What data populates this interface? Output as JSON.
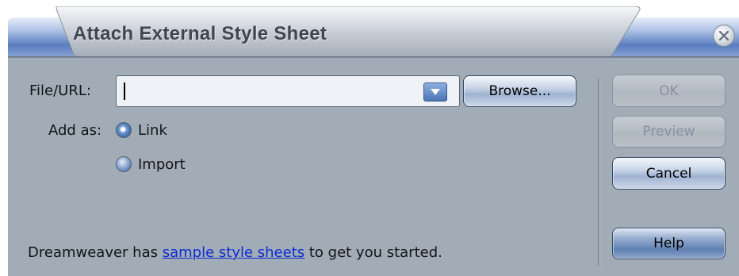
{
  "dialog": {
    "title": "Attach External Style Sheet",
    "close_icon": "close-icon"
  },
  "form": {
    "file_label": "File/URL:",
    "file_value": "",
    "file_placeholder": "",
    "dropdown_icon": "chevron-down-icon",
    "browse_label": "Browse...",
    "add_as_label": "Add as:",
    "options": [
      {
        "label": "Link",
        "selected": true
      },
      {
        "label": "Import",
        "selected": false
      }
    ]
  },
  "buttons": {
    "ok": "OK",
    "preview": "Preview",
    "cancel": "Cancel",
    "help": "Help"
  },
  "hint": {
    "prefix": "Dreamweaver has ",
    "link": "sample style sheets",
    "suffix": " to get you started."
  },
  "colors": {
    "panel": "#a2acb7",
    "titlebar_blue": "#5d7fc0",
    "link": "#0b2bcf",
    "disabled_text": "#8790a0"
  }
}
